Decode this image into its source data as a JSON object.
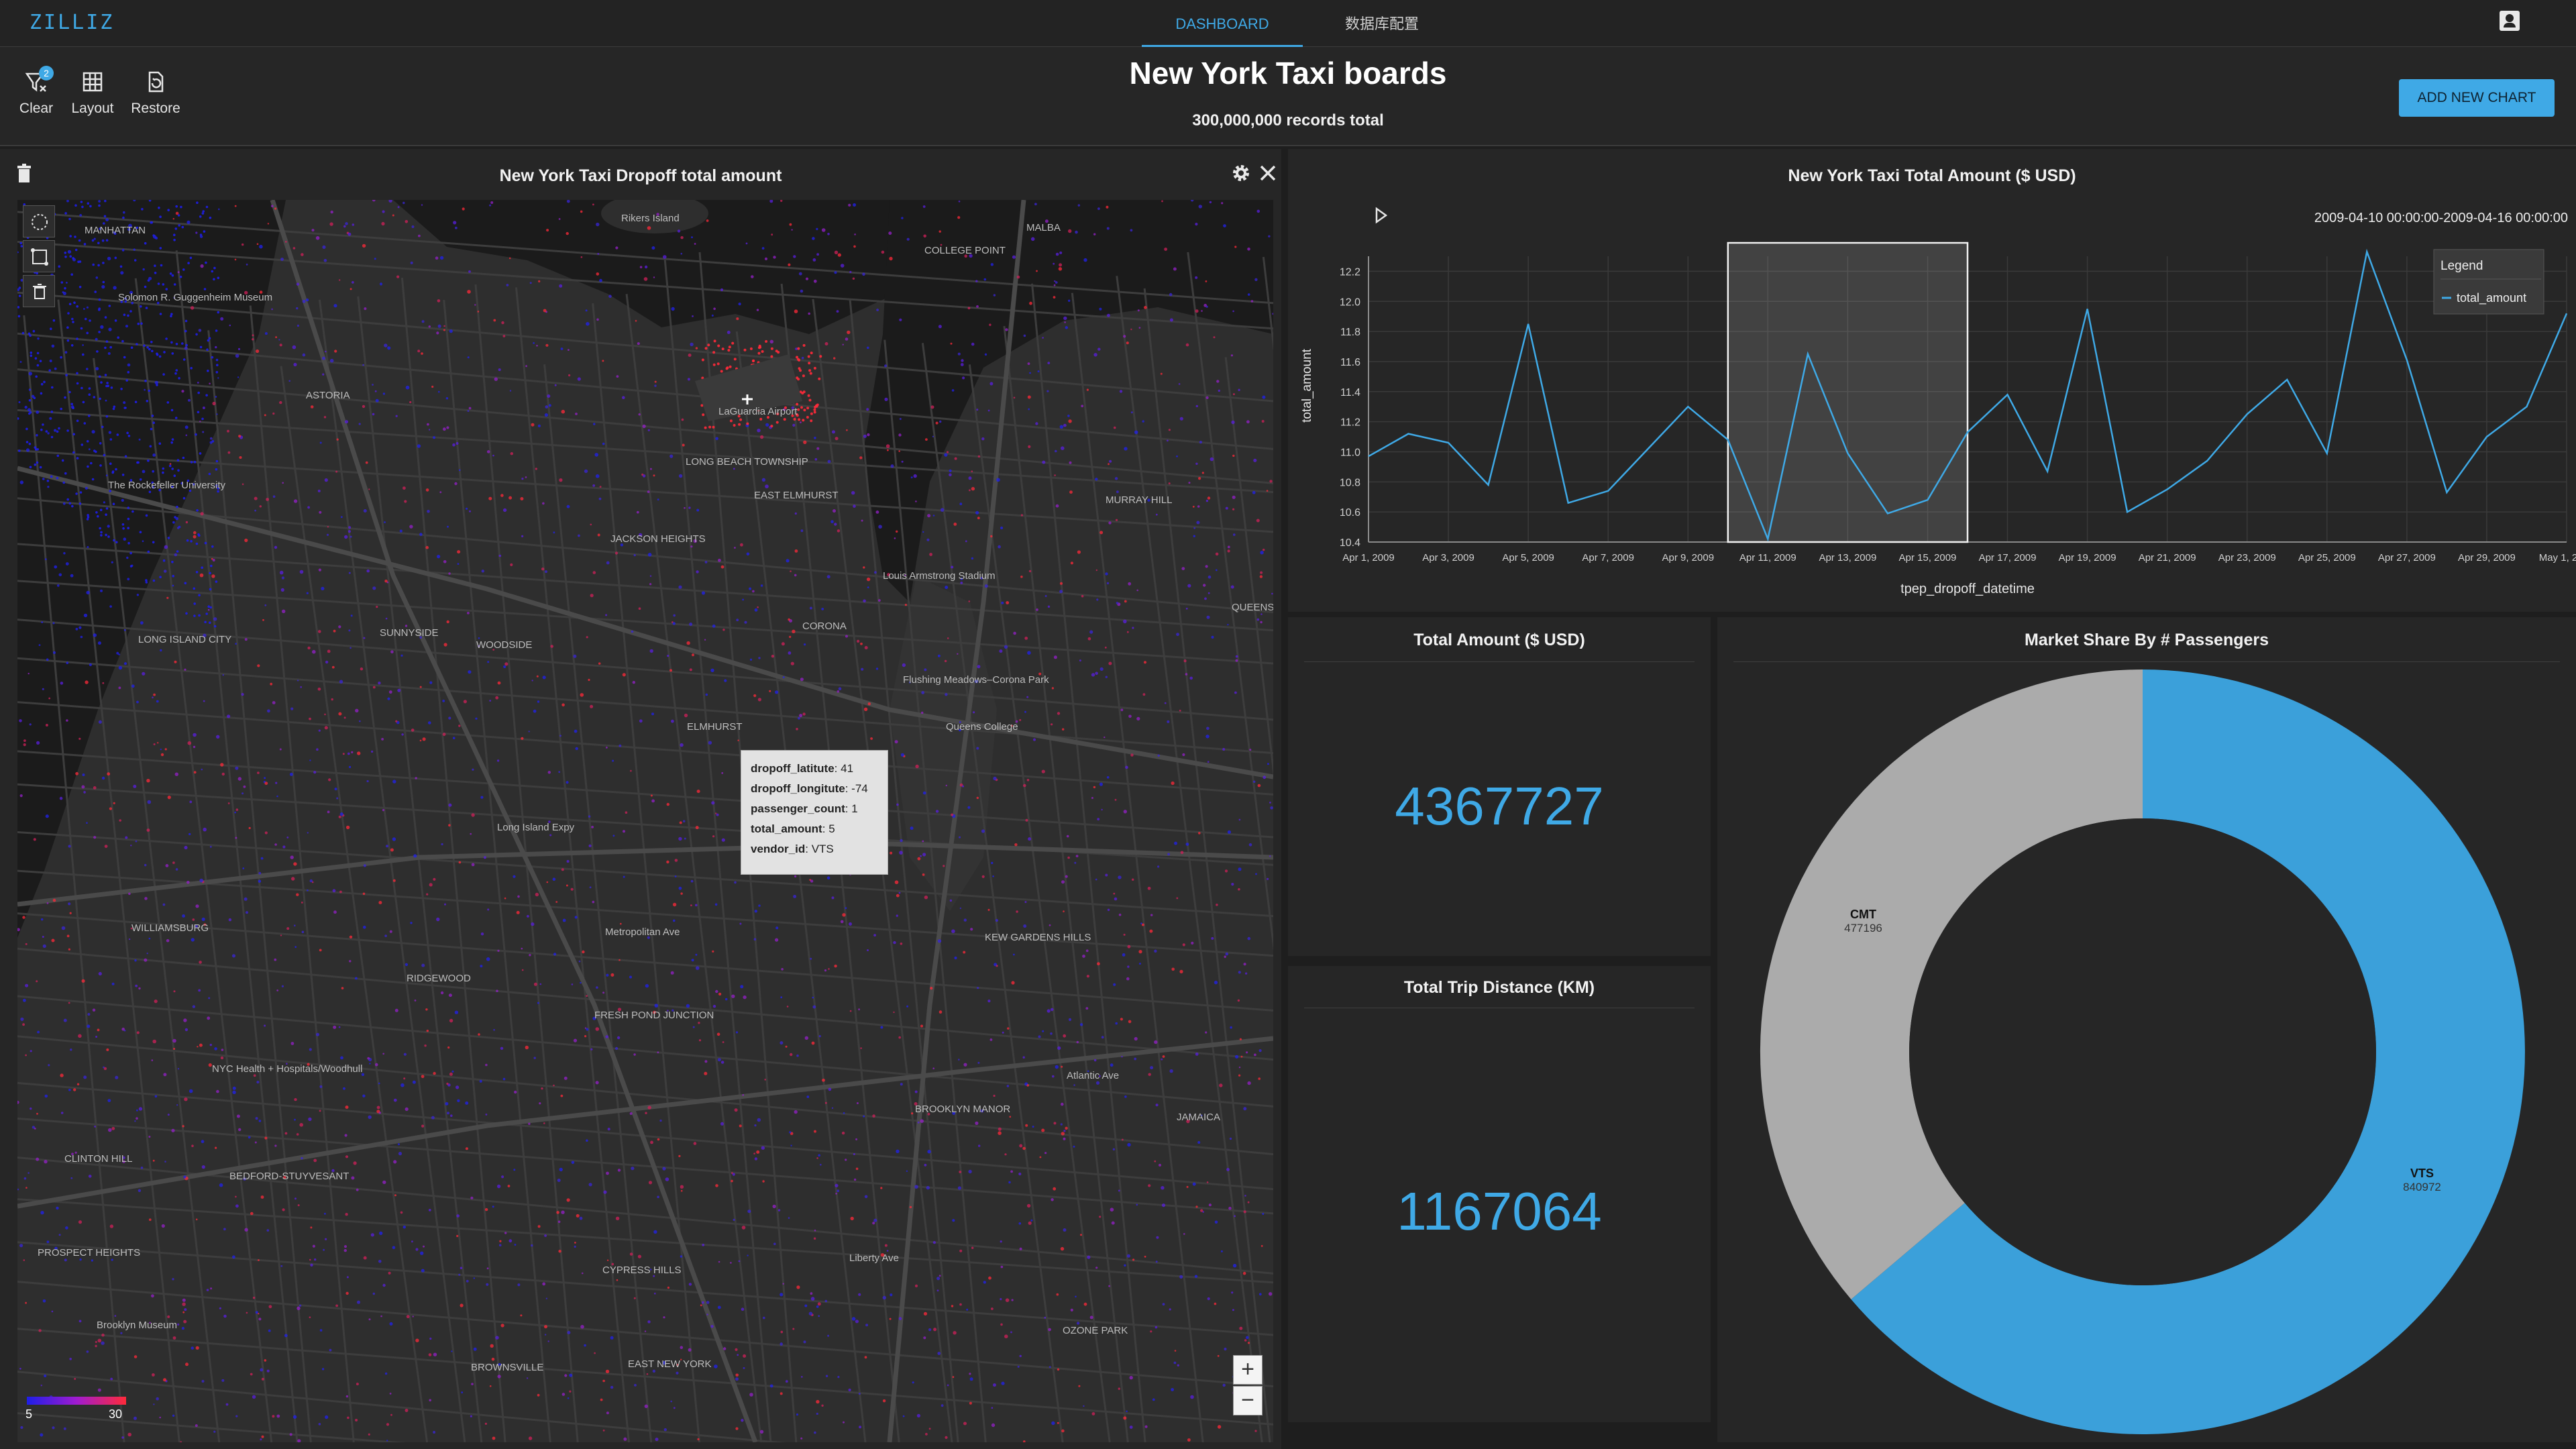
{
  "topnav": {
    "logo": "ZILLIZ",
    "tabs": [
      {
        "label": "DASHBOARD",
        "active": true
      },
      {
        "label": "数据库配置",
        "active": false
      }
    ],
    "account_icon": "account-box-icon"
  },
  "header": {
    "title": "New York Taxi boards",
    "subtitle": "300,000,000 records total",
    "add_chart_label": "ADD NEW CHART",
    "tools": {
      "clear_label": "Clear",
      "clear_badge": "2",
      "layout_label": "Layout",
      "restore_label": "Restore"
    }
  },
  "map_panel": {
    "title": "New York Taxi Dropoff total amount",
    "legend_min": "5",
    "legend_max": "30",
    "zoom_in": "+",
    "zoom_out": "−",
    "place_labels": [
      "Rikers Island",
      "LaGuardia Airport",
      "MANHATTAN",
      "ASTORIA",
      "Solomon R. Guggenheim Museum",
      "The Rockefeller University",
      "LONG ISLAND CITY",
      "SUNNYSIDE",
      "WOODSIDE",
      "JACKSON HEIGHTS",
      "CORONA",
      "EAST ELMHURST",
      "LONG BEACH TOWNSHIP",
      "Louis Armstrong Stadium",
      "ELMHURST",
      "Flushing Meadows–Corona Park",
      "Queens College",
      "MURRAY HILL",
      "QUEENS",
      "WILLIAMSBURG",
      "RIDGEWOOD",
      "FRESH POND JUNCTION",
      "NYC Health + Hospitals/Woodhull",
      "BEDFORD-STUYVESANT",
      "CLINTON HILL",
      "PROSPECT HEIGHTS",
      "Brooklyn Museum",
      "CYPRESS HILLS",
      "BROWNSVILLE",
      "EAST NEW YORK",
      "OZONE PARK",
      "BROOKLYN MANOR",
      "KEW GARDENS HILLS",
      "JAMAICA",
      "COLLEGE POINT",
      "MALBA",
      "Long Island Expy",
      "Metropolitan Ave",
      "Atlantic Ave",
      "Liberty Ave"
    ],
    "tooltip": [
      {
        "key": "dropoff_latitute",
        "value": "41"
      },
      {
        "key": "dropoff_longitute",
        "value": "-74"
      },
      {
        "key": "passenger_count",
        "value": "1"
      },
      {
        "key": "total_amount",
        "value": "5"
      },
      {
        "key": "vendor_id",
        "value": "VTS"
      }
    ],
    "colors": {
      "low": "#1e1ee6",
      "high": "#ff2a3a"
    }
  },
  "line_panel": {
    "title": "New York Taxi Total Amount ($ USD)",
    "range_text": "2009-04-10 00:00:00-2009-04-16 00:00:00",
    "legend_title": "Legend"
  },
  "kpi_total_amount": {
    "title": "Total Amount ($ USD)",
    "value": "4367727"
  },
  "kpi_trip_distance": {
    "title": "Total Trip Distance (KM)",
    "value": "1167064"
  },
  "donut_panel": {
    "title": "Market Share By # Passengers"
  },
  "chart_data": [
    {
      "type": "line",
      "title": "",
      "xlabel": "tpep_dropoff_datetime",
      "ylabel": "total_amount",
      "ylim": [
        10.4,
        12.3
      ],
      "yticks": [
        "10.4",
        "10.6",
        "10.8",
        "11.0",
        "11.2",
        "11.4",
        "11.6",
        "11.8",
        "12.0",
        "12.2"
      ],
      "xticks": [
        "Apr 1, 2009",
        "Apr 3, 2009",
        "Apr 5, 2009",
        "Apr 7, 2009",
        "Apr 9, 2009",
        "Apr 11, 2009",
        "Apr 13, 2009",
        "Apr 15, 2009",
        "Apr 17, 2009",
        "Apr 19, 2009",
        "Apr 21, 2009",
        "Apr 23, 2009",
        "Apr 25, 2009",
        "Apr 27, 2009",
        "Apr 29, 2009",
        "May 1, 2009"
      ],
      "grid": true,
      "legend": "top-right",
      "brush": [
        "2009-04-10",
        "2009-04-16"
      ],
      "series": [
        {
          "name": "total_amount",
          "color": "#3fa9e6",
          "x": [
            "2009-04-01",
            "2009-04-02",
            "2009-04-03",
            "2009-04-04",
            "2009-04-05",
            "2009-04-06",
            "2009-04-07",
            "2009-04-08",
            "2009-04-09",
            "2009-04-10",
            "2009-04-11",
            "2009-04-12",
            "2009-04-13",
            "2009-04-14",
            "2009-04-15",
            "2009-04-16",
            "2009-04-17",
            "2009-04-18",
            "2009-04-19",
            "2009-04-20",
            "2009-04-21",
            "2009-04-22",
            "2009-04-23",
            "2009-04-24",
            "2009-04-25",
            "2009-04-26",
            "2009-04-27",
            "2009-04-28",
            "2009-04-29",
            "2009-04-30",
            "2009-05-01"
          ],
          "values": [
            10.97,
            11.12,
            11.06,
            10.78,
            11.85,
            10.66,
            10.74,
            11.02,
            11.3,
            11.08,
            10.42,
            11.65,
            10.99,
            10.59,
            10.68,
            11.13,
            11.38,
            10.87,
            11.95,
            10.6,
            10.75,
            10.94,
            11.25,
            11.48,
            10.99,
            12.33,
            11.61,
            10.73,
            11.1,
            11.3,
            11.92
          ]
        }
      ]
    },
    {
      "type": "pie",
      "title": "",
      "categories": [
        "VTS",
        "CMT"
      ],
      "values": [
        840972,
        477196
      ],
      "colors": [
        "#3ba0da",
        "#ababab"
      ]
    }
  ]
}
